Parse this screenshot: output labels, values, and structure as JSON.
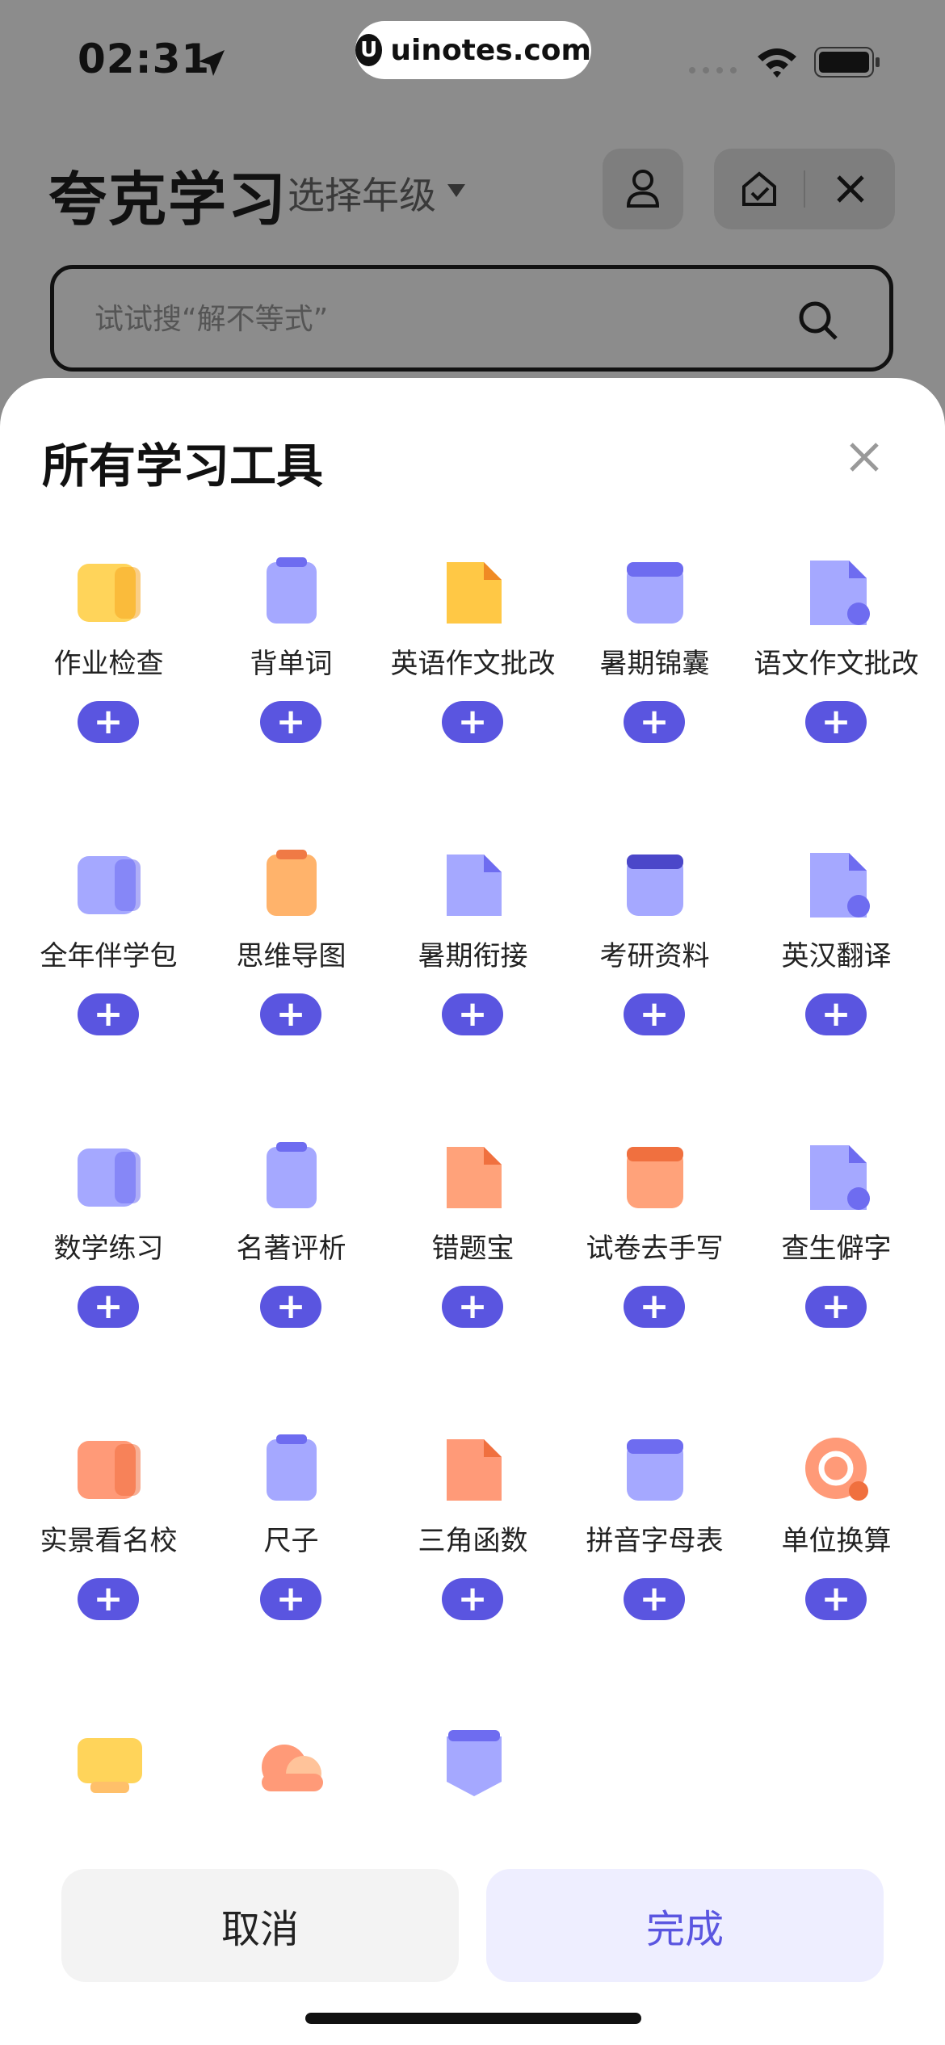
{
  "status_bar": {
    "time": "02:31",
    "watermark": "uinotes.com"
  },
  "header": {
    "app_title": "夸克学习",
    "grade_selector": "选择年级",
    "search_placeholder": "试试搜“解不等式”"
  },
  "sheet": {
    "title": "所有学习工具",
    "tools": [
      {
        "label": "作业检查",
        "icon": "homework-check-icon"
      },
      {
        "label": "背单词",
        "icon": "word-memorize-icon"
      },
      {
        "label": "英语作文批改",
        "icon": "english-essay-icon"
      },
      {
        "label": "暑期锦囊",
        "icon": "summer-kit-icon"
      },
      {
        "label": "语文作文批改",
        "icon": "chinese-essay-icon"
      },
      {
        "label": "全年伴学包",
        "icon": "study-package-icon"
      },
      {
        "label": "思维导图",
        "icon": "mind-map-icon"
      },
      {
        "label": "暑期衔接",
        "icon": "summer-bridge-icon"
      },
      {
        "label": "考研资料",
        "icon": "postgrad-material-icon"
      },
      {
        "label": "英汉翻译",
        "icon": "translate-icon"
      },
      {
        "label": "数学练习",
        "icon": "math-practice-icon"
      },
      {
        "label": "名著评析",
        "icon": "classics-review-icon"
      },
      {
        "label": "错题宝",
        "icon": "mistake-book-icon"
      },
      {
        "label": "试卷去手写",
        "icon": "remove-handwriting-icon"
      },
      {
        "label": "查生僻字",
        "icon": "rare-char-icon"
      },
      {
        "label": "实景看名校",
        "icon": "school-tour-icon"
      },
      {
        "label": "尺子",
        "icon": "ruler-icon"
      },
      {
        "label": "三角函数",
        "icon": "trig-function-icon"
      },
      {
        "label": "拼音字母表",
        "icon": "pinyin-chart-icon"
      },
      {
        "label": "单位换算",
        "icon": "unit-convert-icon"
      },
      {
        "label": "",
        "icon": "binary-icon"
      },
      {
        "label": "",
        "icon": "weather-cloud-icon"
      },
      {
        "label": "",
        "icon": "law-icon"
      }
    ],
    "add_symbol": "+",
    "cancel_label": "取消",
    "done_label": "完成"
  },
  "colors": {
    "accent": "#5a55e0",
    "overlay": "#8c8c8c",
    "done_bg": "#eeeeff"
  }
}
